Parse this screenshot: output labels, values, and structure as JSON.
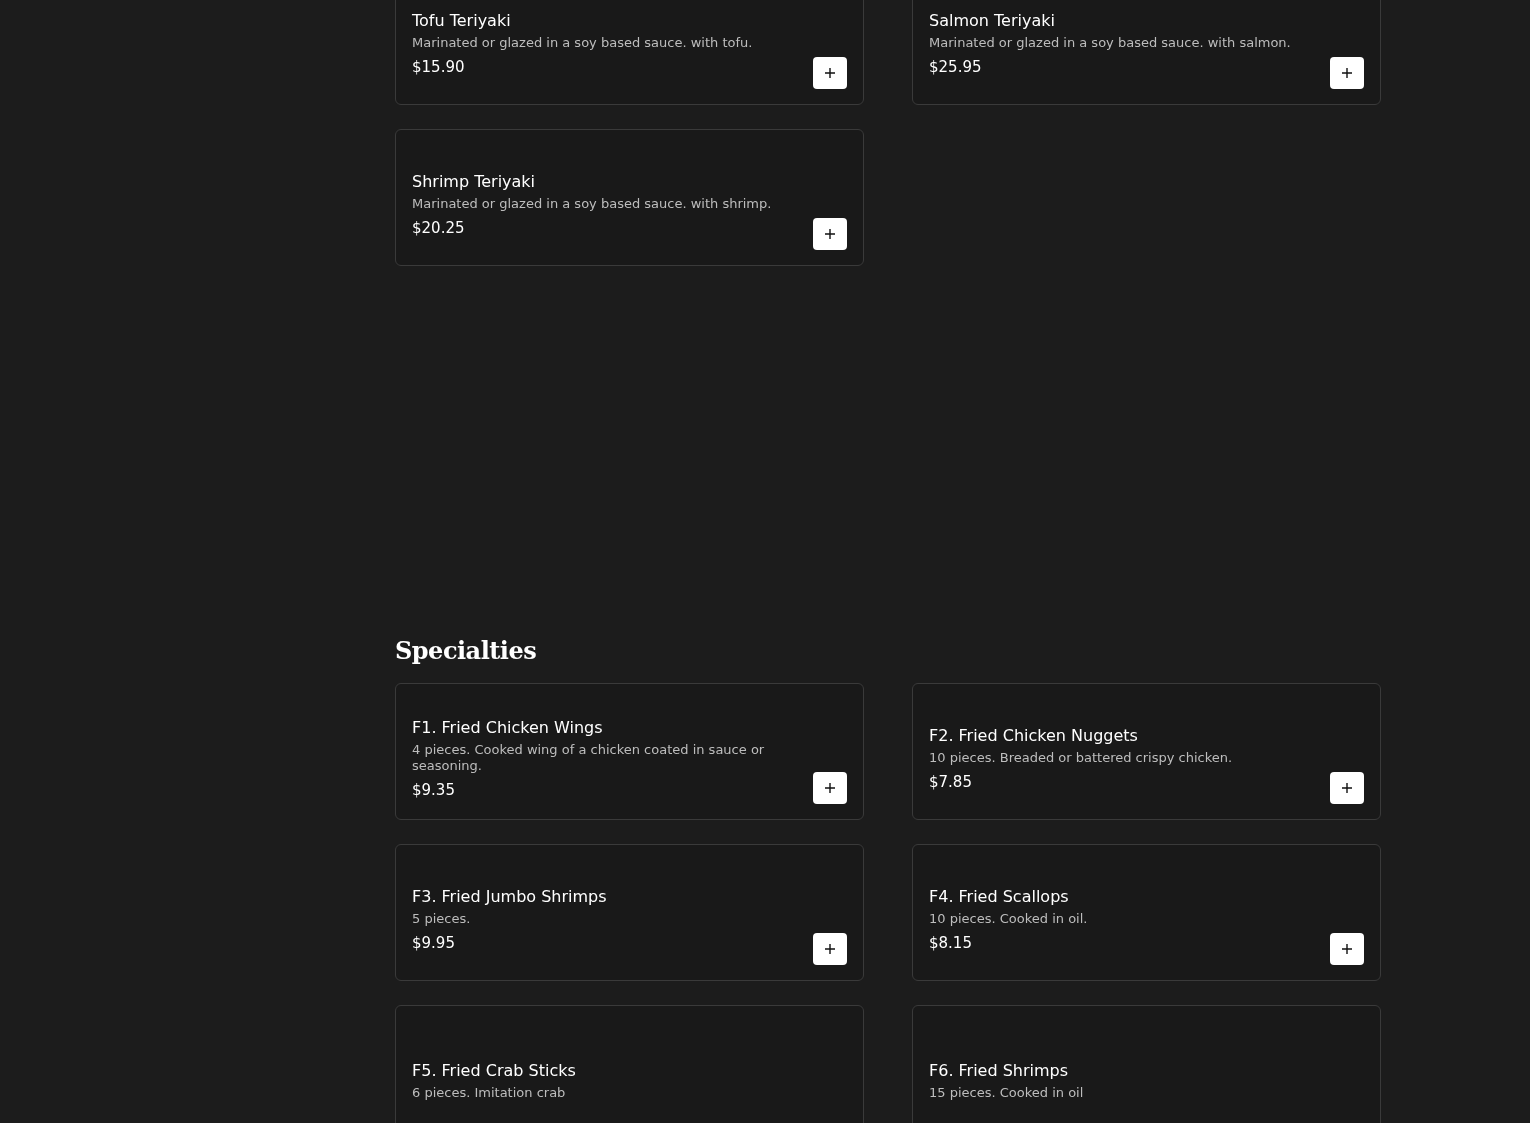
{
  "sections": [
    {
      "items": [
        {
          "name": "Tofu Teriyaki",
          "description": "Marinated or glazed in a soy based sauce. with tofu.",
          "price": "$15.90"
        },
        {
          "name": "Salmon Teriyaki",
          "description": "Marinated or glazed in a soy based sauce. with salmon.",
          "price": "$25.95"
        },
        {
          "name": "Shrimp Teriyaki",
          "description": "Marinated or glazed in a soy based sauce. with shrimp.",
          "price": "$20.25"
        }
      ]
    },
    {
      "heading": "Specialties",
      "items": [
        {
          "name": "F1. Fried Chicken Wings",
          "description": "4 pieces. Cooked wing of a chicken coated in sauce or seasoning.",
          "price": "$9.35"
        },
        {
          "name": "F2. Fried Chicken Nuggets",
          "description": "10 pieces. Breaded or battered crispy chicken.",
          "price": "$7.85"
        },
        {
          "name": "F3. Fried Jumbo Shrimps",
          "description": "5 pieces.",
          "price": "$9.95"
        },
        {
          "name": "F4. Fried Scallops",
          "description": "10 pieces. Cooked in oil.",
          "price": "$8.15"
        },
        {
          "name": "F5. Fried Crab Sticks",
          "description": "6 pieces. Imitation crab"
        },
        {
          "name": "F6. Fried Shrimps",
          "description": "15 pieces. Cooked in oil"
        }
      ]
    }
  ]
}
